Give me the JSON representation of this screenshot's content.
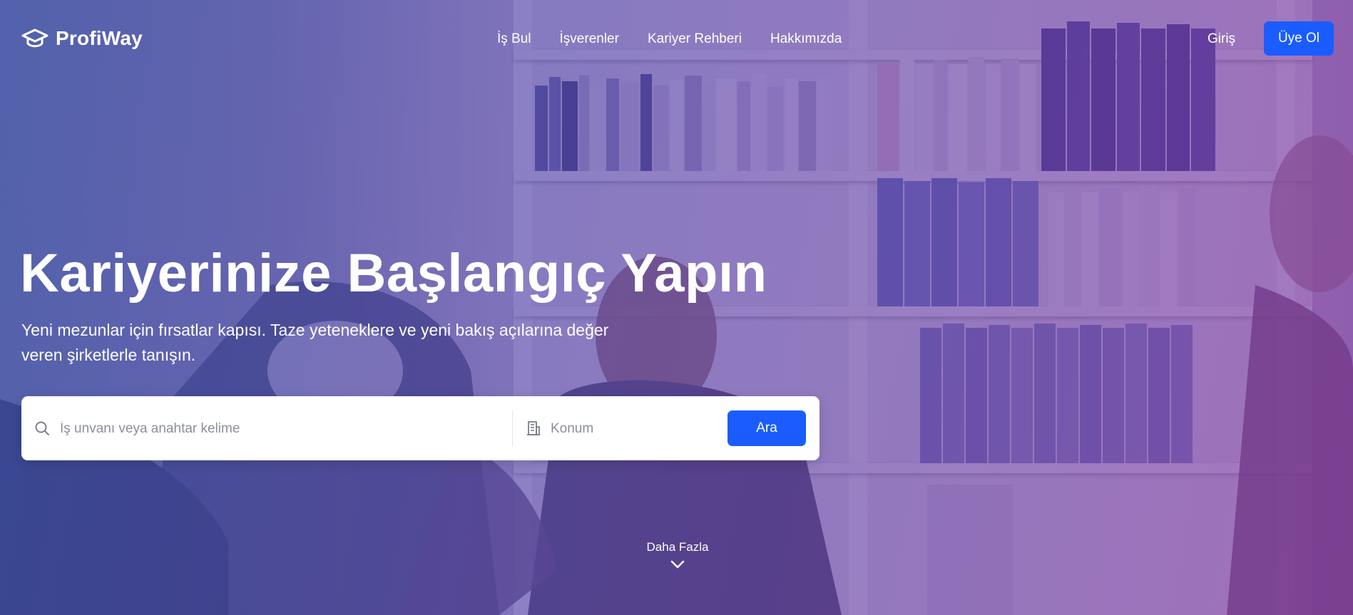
{
  "brand": {
    "name": "ProfiWay",
    "icon": "graduation-cap-icon"
  },
  "nav": {
    "links": [
      "İş Bul",
      "İşverenler",
      "Kariyer Rehberi",
      "Hakkımızda"
    ],
    "login_label": "Giriş",
    "signup_label": "Üye Ol"
  },
  "hero": {
    "title": "Kariyerinize Başlangıç Yapın",
    "subtitle": "Yeni mezunlar için fırsatlar kapısı. Taze yeteneklere ve yeni bakış açılarına değer veren şirketlerle tanışın."
  },
  "search": {
    "keyword_placeholder": "İş unvanı veya anahtar kelime",
    "keyword_value": "",
    "location_placeholder": "Konum",
    "location_value": "",
    "button_label": "Ara",
    "search_icon": "search-icon",
    "location_icon": "building-icon"
  },
  "more": {
    "label": "Daha Fazla",
    "icon": "chevron-down-icon"
  },
  "colors": {
    "accent": "#1a5cff",
    "overlay_start": "#3c50aa",
    "overlay_end": "#7d37a0",
    "text": "#ffffff"
  }
}
